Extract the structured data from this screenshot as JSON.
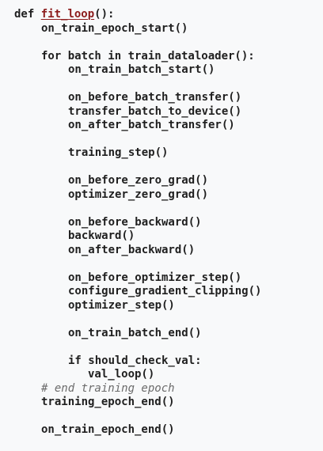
{
  "code": {
    "def_keyword": "def",
    "function_name": "fit_loop",
    "def_suffix": "():",
    "lines": {
      "on_train_epoch_start": "on_train_epoch_start()",
      "for_loop": "for batch in train_dataloader():",
      "on_train_batch_start": "on_train_batch_start()",
      "on_before_batch_transfer": "on_before_batch_transfer()",
      "transfer_batch_to_device": "transfer_batch_to_device()",
      "on_after_batch_transfer": "on_after_batch_transfer()",
      "training_step": "training_step()",
      "on_before_zero_grad": "on_before_zero_grad()",
      "optimizer_zero_grad": "optimizer_zero_grad()",
      "on_before_backward": "on_before_backward()",
      "backward": "backward()",
      "on_after_backward": "on_after_backward()",
      "on_before_optimizer_step": "on_before_optimizer_step()",
      "configure_gradient_clipping": "configure_gradient_clipping()",
      "optimizer_step": "optimizer_step()",
      "on_train_batch_end": "on_train_batch_end()",
      "if_should_check_val": "if should_check_val:",
      "val_loop": "val_loop()",
      "comment_end_training_epoch": "# end training epoch",
      "training_epoch_end": "training_epoch_end()",
      "on_train_epoch_end": "on_train_epoch_end()"
    }
  }
}
